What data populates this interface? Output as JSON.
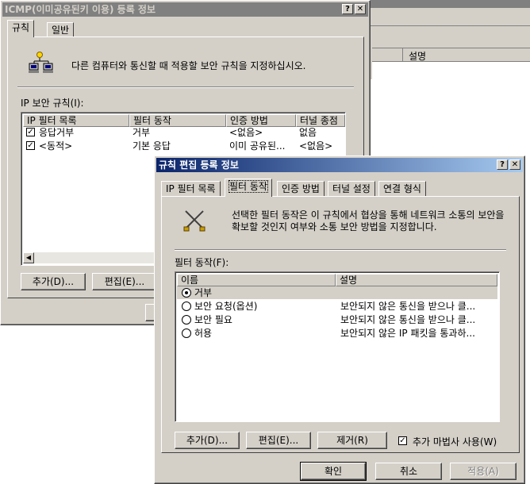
{
  "bg_window": {
    "col_label": "설명"
  },
  "outer_dialog": {
    "title": "ICMP(이미공유된키 이용) 등록 정보",
    "help_btn": "?",
    "close_btn": "✕",
    "tabs": [
      "규칙",
      "일반"
    ],
    "description": "다른 컴퓨터와 통신할 때 적용할 보안 규칙을 지정하십시오.",
    "rules_label": "IP 보안 규칙(I):",
    "columns": [
      "IP 필터 목록",
      "필터 동작",
      "인증 방법",
      "터널 종점"
    ],
    "rows": [
      {
        "checked": "✓",
        "filter_list": "응답거부",
        "action": "거부",
        "auth": "<없음>",
        "tunnel": "없음"
      },
      {
        "checked": "✓",
        "filter_list": "<동적>",
        "action": "기본 응답",
        "auth": "이미 공유된...",
        "tunnel": "<없음>"
      }
    ],
    "add_btn": "추가(D)...",
    "edit_btn": "편집(E)..."
  },
  "inner_dialog": {
    "title": "규칙 편집 등록 정보",
    "help_btn": "?",
    "close_btn": "✕",
    "tabs": [
      "IP 필터 목록",
      "필터 동작",
      "인증 방법",
      "터널 설정",
      "연결 형식"
    ],
    "description": "선택한 필터 동작은 이 규칙에서 협상을 통해 네트워크 소통의 보안을 확보할 것인지 여부와 소통 보안 방법을 지정합니다.",
    "actions_label": "필터 동작(F):",
    "columns": [
      "이름",
      "설명"
    ],
    "rows": [
      {
        "name": "거부",
        "desc": "",
        "selected": true
      },
      {
        "name": "보안 요청(옵션)",
        "desc": "보안되지 않은 통신을 받으나 클...",
        "selected": false
      },
      {
        "name": "보안 필요",
        "desc": "보안되지 않은 통신을 받으나 클...",
        "selected": false
      },
      {
        "name": "허용",
        "desc": "보안되지 않은 IP 패킷을 통과하...",
        "selected": false
      }
    ],
    "add_btn": "추가(D)...",
    "edit_btn": "편집(E)...",
    "remove_btn": "제거(R)",
    "wizard_checkbox": "✓",
    "wizard_label": "추가 마법사 사용(W)",
    "ok_btn": "확인",
    "cancel_btn": "취소",
    "apply_btn": "적용(A)"
  }
}
